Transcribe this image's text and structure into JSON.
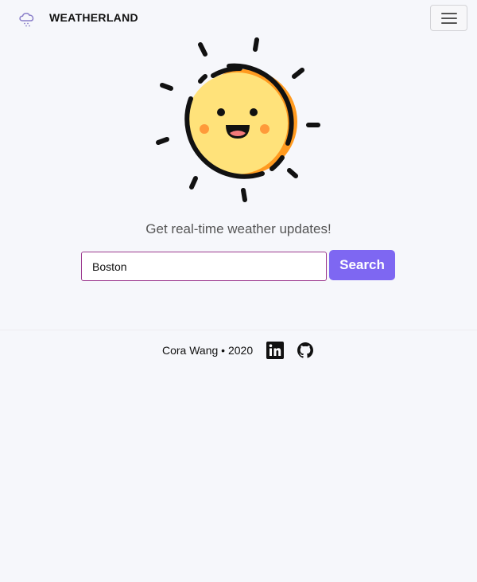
{
  "navbar": {
    "brand_name": "WEATHERLAND",
    "brand_icon": "cloud-rain-icon",
    "menu_icon": "hamburger-menu-icon"
  },
  "hero": {
    "illustration": "smiling-sun-icon",
    "tagline": "Get real-time weather updates!"
  },
  "search": {
    "value": "Boston",
    "button_label": "Search"
  },
  "footer": {
    "credit": "Cora Wang • 2020",
    "links": [
      {
        "icon": "linkedin-icon"
      },
      {
        "icon": "github-icon"
      }
    ]
  },
  "colors": {
    "background": "#f6f7fb",
    "accent": "#7e67f2",
    "input_border": "#9c3a8f",
    "sun_fill": "#ffe27a",
    "sun_shadow": "#ff9a1f"
  }
}
